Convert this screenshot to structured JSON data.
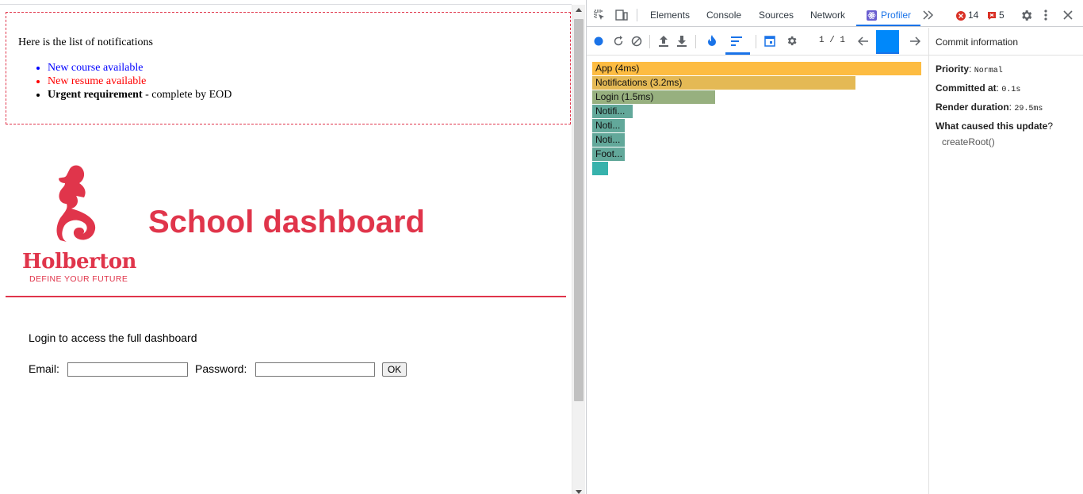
{
  "page": {
    "notifications": {
      "intro": "Here is the list of notifications",
      "items": [
        {
          "type": "default",
          "text": "New course available"
        },
        {
          "type": "urgent",
          "text": "New resume available"
        },
        {
          "type": "html",
          "strong": "Urgent requirement",
          "rest": " - complete by EOD"
        }
      ]
    },
    "logo": {
      "word": "Holberton",
      "tagline": "DEFINE YOUR FUTURE"
    },
    "title": "School dashboard",
    "login": {
      "intro": "Login to access the full dashboard",
      "email_label": "Email:",
      "password_label": "Password:",
      "ok_label": "OK"
    },
    "colors": {
      "brand": "#e0354b"
    }
  },
  "devtools": {
    "tabs": [
      "Elements",
      "Console",
      "Sources",
      "Network",
      "Profiler"
    ],
    "active_tab": "Profiler",
    "error_count": "14",
    "warning_count": "5",
    "commit_counter": "1 / 1",
    "flamegraph": [
      {
        "label": "App (4ms)",
        "color": "#fdbc42"
      },
      {
        "label": "Notifications (3.2ms)",
        "color": "#e4b955"
      },
      {
        "label": "Login (1.5ms)",
        "color": "#97b07f"
      },
      {
        "label": "Notifi...",
        "color": "#62a89a"
      },
      {
        "label": "Noti...",
        "color": "#62a89a"
      },
      {
        "label": "Noti...",
        "color": "#62a89a"
      },
      {
        "label": "Foot...",
        "color": "#62a89a"
      },
      {
        "label": "",
        "color": "#37b2ac"
      }
    ],
    "commit_info": {
      "header": "Commit information",
      "priority_label": "Priority",
      "priority_value": "Normal",
      "committed_label": "Committed at",
      "committed_value": "0.1s",
      "duration_label": "Render duration",
      "duration_value": "29.5ms",
      "cause_label": "What caused this update",
      "cause_q": "?",
      "cause_value": "createRoot()"
    }
  }
}
